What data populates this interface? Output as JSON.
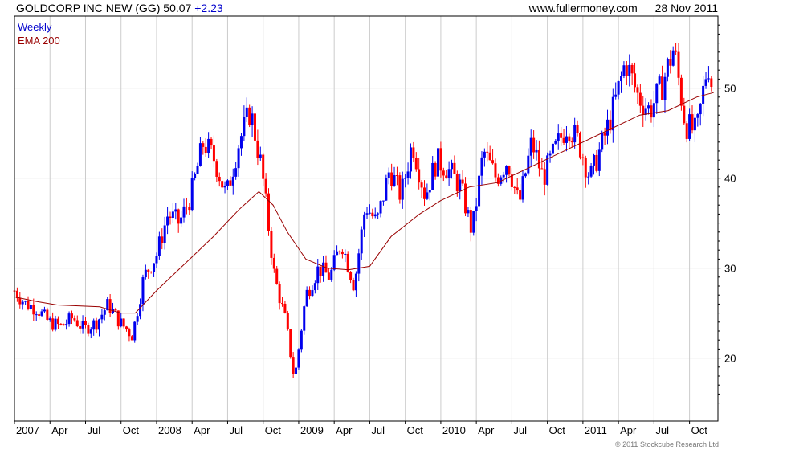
{
  "header": {
    "title": "GOLDCORP INC NEW (GG) 50.07",
    "change": "+2.23",
    "site": "www.fullermoney.com",
    "date": "28 Nov 2011"
  },
  "legend": {
    "weekly": "Weekly",
    "ema": "EMA 200"
  },
  "copyright": "© 2011 Stockcube Research Ltd",
  "colors": {
    "up": "#0000ee",
    "down": "#ff0000",
    "ema": "#990000",
    "grid": "#cccccc",
    "axis": "#000000"
  },
  "chart_data": {
    "type": "line",
    "x_ticks": [
      "2007",
      "Apr",
      "Jul",
      "Oct",
      "2008",
      "Apr",
      "Jul",
      "Oct",
      "2009",
      "Apr",
      "Jul",
      "Oct",
      "2010",
      "Apr",
      "Jul",
      "Oct",
      "2011",
      "Apr",
      "Jul",
      "Oct"
    ],
    "y_ticks": [
      "20",
      "30",
      "40",
      "50"
    ],
    "y_tick_values": [
      20,
      30,
      40,
      50
    ],
    "ylim": [
      13,
      58
    ],
    "xlim": [
      2007.0,
      2011.95
    ],
    "series": [
      {
        "name": "Weekly",
        "style": "ohlc-candles",
        "points": [
          [
            2007.0,
            27.5
          ],
          [
            2007.08,
            26.0
          ],
          [
            2007.16,
            25.5
          ],
          [
            2007.24,
            24.0
          ],
          [
            2007.33,
            23.5
          ],
          [
            2007.41,
            24.5
          ],
          [
            2007.49,
            23.2
          ],
          [
            2007.58,
            24.0
          ],
          [
            2007.66,
            26.0
          ],
          [
            2007.74,
            24.0
          ],
          [
            2007.83,
            22.5
          ],
          [
            2007.91,
            29.0
          ],
          [
            2008.0,
            31.5
          ],
          [
            2008.08,
            36.0
          ],
          [
            2008.16,
            35.0
          ],
          [
            2008.24,
            38.0
          ],
          [
            2008.33,
            44.0
          ],
          [
            2008.41,
            42.0
          ],
          [
            2008.49,
            38.0
          ],
          [
            2008.58,
            44.0
          ],
          [
            2008.66,
            47.5
          ],
          [
            2008.74,
            41.0
          ],
          [
            2008.83,
            29.0
          ],
          [
            2008.91,
            24.0
          ],
          [
            2008.97,
            17.5
          ],
          [
            2009.05,
            27.0
          ],
          [
            2009.14,
            30.0
          ],
          [
            2009.22,
            29.0
          ],
          [
            2009.3,
            33.0
          ],
          [
            2009.39,
            28.0
          ],
          [
            2009.47,
            37.0
          ],
          [
            2009.55,
            35.0
          ],
          [
            2009.64,
            41.0
          ],
          [
            2009.72,
            38.0
          ],
          [
            2009.8,
            44.0
          ],
          [
            2009.89,
            38.0
          ],
          [
            2009.97,
            42.0
          ],
          [
            2010.05,
            41.0
          ],
          [
            2010.14,
            39.0
          ],
          [
            2010.22,
            34.0
          ],
          [
            2010.3,
            43.0
          ],
          [
            2010.39,
            40.0
          ],
          [
            2010.47,
            42.0
          ],
          [
            2010.55,
            37.0
          ],
          [
            2010.64,
            44.0
          ],
          [
            2010.72,
            40.0
          ],
          [
            2010.8,
            43.0
          ],
          [
            2010.89,
            46.0
          ],
          [
            2010.97,
            44.0
          ],
          [
            2011.05,
            40.0
          ],
          [
            2011.14,
            44.0
          ],
          [
            2011.22,
            48.0
          ],
          [
            2011.3,
            53.0
          ],
          [
            2011.39,
            49.0
          ],
          [
            2011.47,
            47.5
          ],
          [
            2011.55,
            50.0
          ],
          [
            2011.64,
            54.5
          ],
          [
            2011.72,
            46.0
          ],
          [
            2011.8,
            45.0
          ],
          [
            2011.88,
            53.0
          ],
          [
            2011.91,
            50.07
          ]
        ]
      },
      {
        "name": "EMA 200",
        "style": "line",
        "points": [
          [
            2007.0,
            26.8
          ],
          [
            2007.15,
            26.3
          ],
          [
            2007.3,
            25.9
          ],
          [
            2007.45,
            25.8
          ],
          [
            2007.6,
            25.7
          ],
          [
            2007.75,
            25.0
          ],
          [
            2007.85,
            25.0
          ],
          [
            2008.0,
            27.5
          ],
          [
            2008.2,
            30.5
          ],
          [
            2008.4,
            33.5
          ],
          [
            2008.58,
            36.5
          ],
          [
            2008.72,
            38.5
          ],
          [
            2008.82,
            37.0
          ],
          [
            2008.92,
            34.0
          ],
          [
            2009.05,
            31.0
          ],
          [
            2009.2,
            30.0
          ],
          [
            2009.35,
            29.8
          ],
          [
            2009.5,
            30.2
          ],
          [
            2009.65,
            33.5
          ],
          [
            2009.85,
            36.0
          ],
          [
            2010.0,
            37.5
          ],
          [
            2010.2,
            39.0
          ],
          [
            2010.4,
            39.5
          ],
          [
            2010.6,
            41.0
          ],
          [
            2010.8,
            42.5
          ],
          [
            2011.0,
            44.0
          ],
          [
            2011.2,
            45.5
          ],
          [
            2011.4,
            47.0
          ],
          [
            2011.6,
            47.5
          ],
          [
            2011.8,
            49.0
          ],
          [
            2011.92,
            49.5
          ]
        ]
      }
    ]
  }
}
